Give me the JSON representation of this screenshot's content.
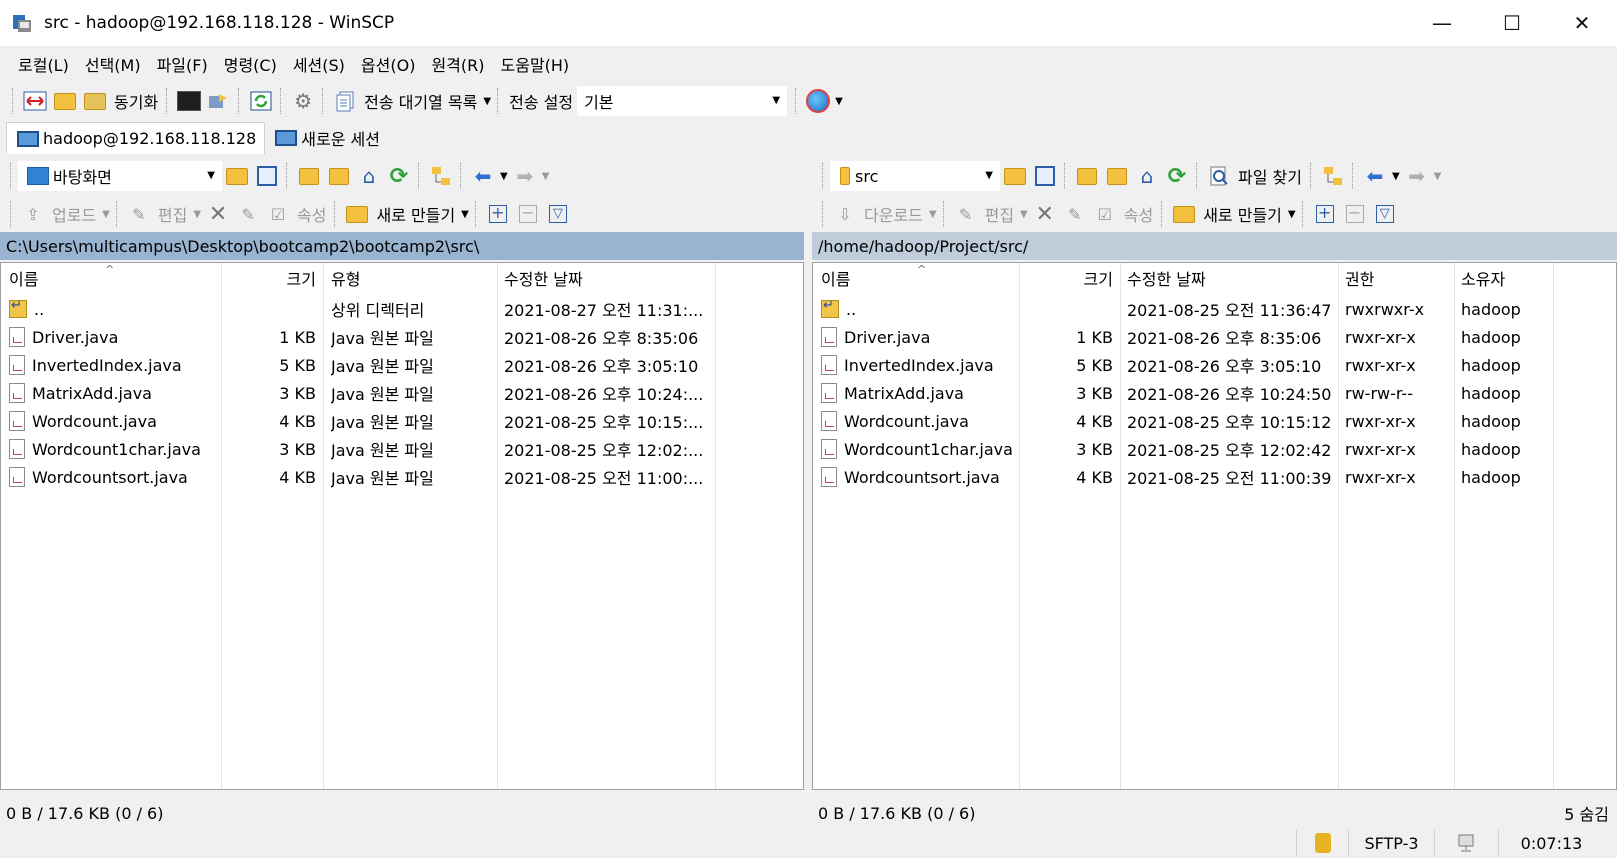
{
  "window": {
    "title": "src - hadoop@192.168.118.128 - WinSCP",
    "minimize": "—",
    "maximize": "☐",
    "close": "✕"
  },
  "menu": [
    "로컬(L)",
    "선택(M)",
    "파일(F)",
    "명령(C)",
    "세션(S)",
    "옵션(O)",
    "원격(R)",
    "도움말(H)"
  ],
  "toolbar": {
    "sync_label": "동기화",
    "queue_label": "전송 대기열 목록",
    "transfer_settings_label": "전송 설정",
    "transfer_settings_value": "기본"
  },
  "tabs": {
    "session": "hadoop@192.168.118.128",
    "new_session": "새로운 세션"
  },
  "left": {
    "location": "바탕화면",
    "upload": "업로드",
    "edit": "편집",
    "properties": "속성",
    "new": "새로 만들기",
    "path": "C:\\Users\\multicampus\\Desktop\\bootcamp2\\bootcamp2\\src\\",
    "columns": {
      "name": "이름",
      "size": "크기",
      "type": "유형",
      "modified": "수정한 날짜"
    },
    "rows": [
      {
        "name": "..",
        "size": "",
        "type": "상위 디렉터리",
        "modified": "2021-08-27  오전 11:31:..."
      },
      {
        "name": "Driver.java",
        "size": "1 KB",
        "type": "Java 원본 파일",
        "modified": "2021-08-26  오후 8:35:06"
      },
      {
        "name": "InvertedIndex.java",
        "size": "5 KB",
        "type": "Java 원본 파일",
        "modified": "2021-08-26  오후 3:05:10"
      },
      {
        "name": "MatrixAdd.java",
        "size": "3 KB",
        "type": "Java 원본 파일",
        "modified": "2021-08-26  오후 10:24:..."
      },
      {
        "name": "Wordcount.java",
        "size": "4 KB",
        "type": "Java 원본 파일",
        "modified": "2021-08-25  오후 10:15:..."
      },
      {
        "name": "Wordcount1char.java",
        "size": "3 KB",
        "type": "Java 원본 파일",
        "modified": "2021-08-25  오후 12:02:..."
      },
      {
        "name": "Wordcountsort.java",
        "size": "4 KB",
        "type": "Java 원본 파일",
        "modified": "2021-08-25  오전 11:00:..."
      }
    ],
    "status": "0 B / 17.6 KB (0 / 6)"
  },
  "right": {
    "location": "src",
    "find": "파일 찾기",
    "download": "다운로드",
    "edit": "편집",
    "properties": "속성",
    "new": "새로 만들기",
    "path": "/home/hadoop/Project/src/",
    "columns": {
      "name": "이름",
      "size": "크기",
      "modified": "수정한 날짜",
      "rights": "권한",
      "owner": "소유자"
    },
    "rows": [
      {
        "name": "..",
        "size": "",
        "modified": "2021-08-25 오전 11:36:47",
        "rights": "rwxrwxr-x",
        "owner": "hadoop"
      },
      {
        "name": "Driver.java",
        "size": "1 KB",
        "modified": "2021-08-26 오후 8:35:06",
        "rights": "rwxr-xr-x",
        "owner": "hadoop"
      },
      {
        "name": "InvertedIndex.java",
        "size": "5 KB",
        "modified": "2021-08-26 오후 3:05:10",
        "rights": "rwxr-xr-x",
        "owner": "hadoop"
      },
      {
        "name": "MatrixAdd.java",
        "size": "3 KB",
        "modified": "2021-08-26 오후 10:24:50",
        "rights": "rw-rw-r--",
        "owner": "hadoop"
      },
      {
        "name": "Wordcount.java",
        "size": "4 KB",
        "modified": "2021-08-25 오후 10:15:12",
        "rights": "rwxr-xr-x",
        "owner": "hadoop"
      },
      {
        "name": "Wordcount1char.java",
        "size": "3 KB",
        "modified": "2021-08-25 오후 12:02:42",
        "rights": "rwxr-xr-x",
        "owner": "hadoop"
      },
      {
        "name": "Wordcountsort.java",
        "size": "4 KB",
        "modified": "2021-08-25 오전 11:00:39",
        "rights": "rwxr-xr-x",
        "owner": "hadoop"
      }
    ],
    "status": "0 B / 17.6 KB (0 / 6)",
    "hidden": "5 숨김"
  },
  "statusbar": {
    "protocol": "SFTP-3",
    "elapsed": "0:07:13"
  },
  "colors": {
    "left_path_bg": "#99b4d1",
    "right_path_bg": "#bfcddb",
    "chrome_bg": "#f0f0f0"
  }
}
